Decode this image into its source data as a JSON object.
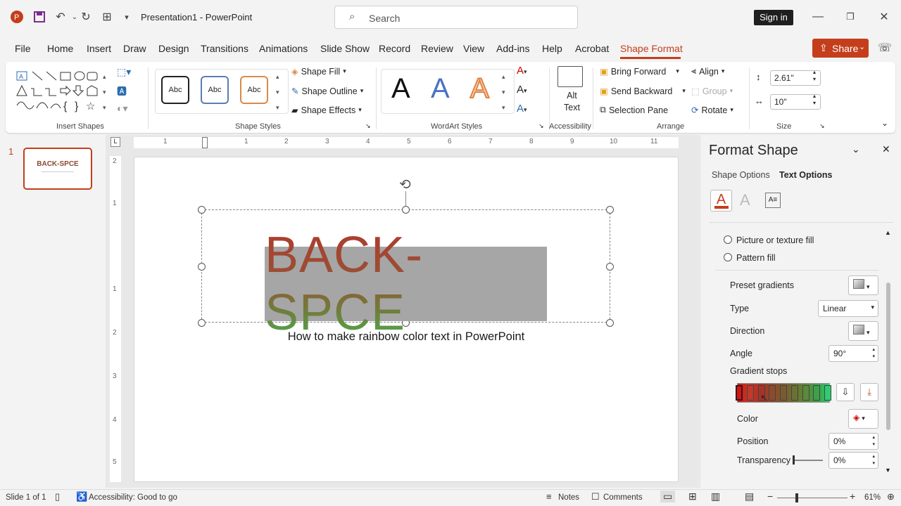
{
  "titlebar": {
    "doc_title": "Presentation1",
    "separator": " - ",
    "app_name": "PowerPoint",
    "search_placeholder": "Search",
    "signin_label": "Sign in"
  },
  "tabs": [
    {
      "label": "File"
    },
    {
      "label": "Home"
    },
    {
      "label": "Insert"
    },
    {
      "label": "Draw"
    },
    {
      "label": "Design"
    },
    {
      "label": "Transitions"
    },
    {
      "label": "Animations"
    },
    {
      "label": "Slide Show"
    },
    {
      "label": "Record"
    },
    {
      "label": "Review"
    },
    {
      "label": "View"
    },
    {
      "label": "Add-ins"
    },
    {
      "label": "Help"
    },
    {
      "label": "Acrobat"
    },
    {
      "label": "Shape Format"
    }
  ],
  "share_label": "Share",
  "ribbon": {
    "groups": {
      "insert_shapes": "Insert Shapes",
      "shape_styles": "Shape Styles",
      "wordart_styles": "WordArt Styles",
      "accessibility": "Accessibility",
      "arrange": "Arrange",
      "size": "Size"
    },
    "style_box_label": "Abc",
    "shape_fill": "Shape Fill",
    "shape_outline": "Shape Outline",
    "shape_effects": "Shape Effects",
    "wordart_letter": "A",
    "alt_text_line1": "Alt",
    "alt_text_line2": "Text",
    "bring_forward": "Bring Forward",
    "send_backward": "Send Backward",
    "selection_pane": "Selection Pane",
    "align": "Align",
    "group": "Group",
    "rotate": "Rotate",
    "height": "2.61\"",
    "width": "10\""
  },
  "thumbnail": {
    "number": "1",
    "title": "BACK-SPCE"
  },
  "rulers": {
    "h": [
      "1",
      "1",
      "2",
      "3",
      "4",
      "5",
      "6",
      "7",
      "8",
      "9",
      "10",
      "11"
    ],
    "v": [
      "2",
      "1",
      "1",
      "2",
      "3",
      "4",
      "5"
    ]
  },
  "slide": {
    "wordart_text": "BACK-SPCE",
    "caption": "How to make rainbow color text in PowerPoint"
  },
  "pane": {
    "title": "Format Shape",
    "tab_shape": "Shape Options",
    "tab_text": "Text Options",
    "picture_fill": "Picture or texture fill",
    "pattern_fill": "Pattern fill",
    "preset_gradients": "Preset gradients",
    "type_label": "Type",
    "type_value": "Linear",
    "direction_label": "Direction",
    "angle_label": "Angle",
    "angle_value": "90°",
    "gradient_stops": "Gradient stops",
    "color_label": "Color",
    "position_label": "Position",
    "position_value": "0%",
    "transparency_label": "Transparency",
    "transparency_value": "0%",
    "gradient_colors": [
      "#e01010",
      "#c0392b",
      "#a93226",
      "#8e4a2a",
      "#7a5a30",
      "#6b7033",
      "#5b8a3a",
      "#3ea04a",
      "#2ecc71"
    ]
  },
  "status": {
    "slide_of": "Slide 1 of 1",
    "accessibility": "Accessibility: Good to go",
    "notes": "Notes",
    "comments": "Comments",
    "zoom": "61%"
  },
  "colors": {
    "accent": "#c43e1c",
    "dark": "#1f1f1f"
  }
}
